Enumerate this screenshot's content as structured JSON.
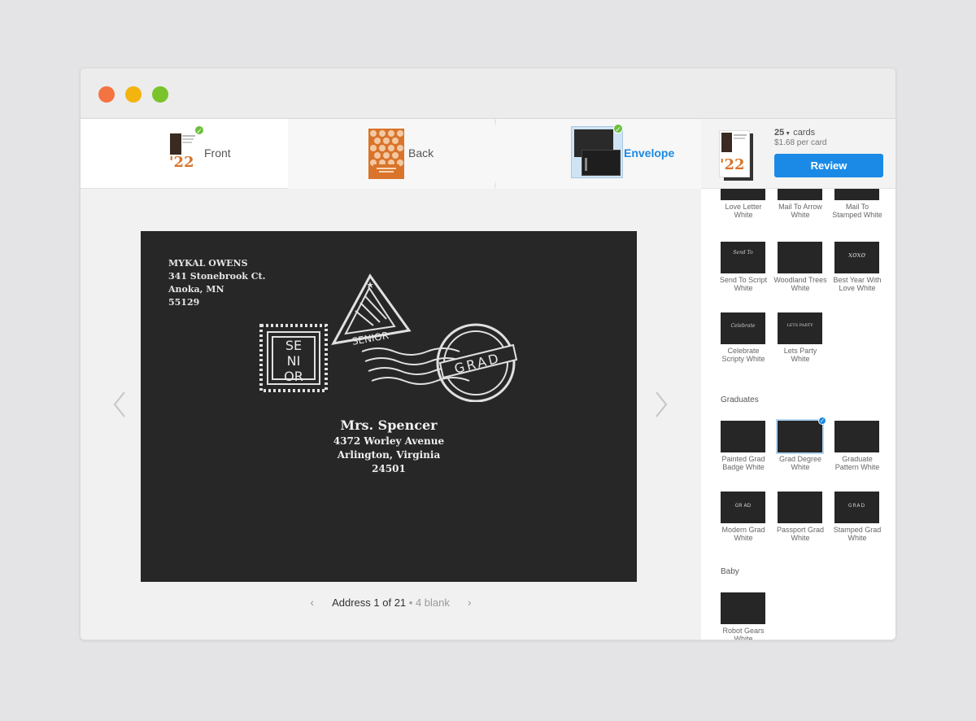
{
  "steps": [
    {
      "label": "Front",
      "completed": true
    },
    {
      "label": "Back",
      "completed": false
    },
    {
      "label": "Envelope",
      "completed": true,
      "active": true
    }
  ],
  "thumb_year": "'22",
  "order": {
    "quantity": "25",
    "unit": "cards",
    "price": "$1.68 per card",
    "review_label": "Review"
  },
  "envelope": {
    "return_address": [
      "MYKAL OWENS",
      "341 Stonebrook Ct.",
      "Anoka, MN",
      "55129"
    ],
    "recipient": {
      "name": "Mrs. Spencer",
      "lines": [
        "4372 Worley Avenue",
        "Arlington, Virginia",
        "24501"
      ]
    },
    "stamps": {
      "square_lines": [
        "SE",
        "NI",
        "OR"
      ],
      "triangle": "SENIOR",
      "round": "GRAD"
    }
  },
  "pager": {
    "label": "Address 1 of 21",
    "separator": "•",
    "blank": "4 blank"
  },
  "sidebar": {
    "sections": [
      {
        "title": "",
        "items": [
          {
            "label": "Love Letter White"
          },
          {
            "label": "Mail To Arrow White"
          },
          {
            "label": "Mail To Stamped White"
          },
          {
            "label": "Send To Script White",
            "inner": "Send To"
          },
          {
            "label": "Woodland Trees White"
          },
          {
            "label": "Best Year With Love White",
            "inner": "xoxo"
          },
          {
            "label": "Celebrate Scripty White",
            "inner": "Celebrate"
          },
          {
            "label": "Lets Party White",
            "inner": "LETS PARTY"
          }
        ]
      },
      {
        "title": "Graduates",
        "items": [
          {
            "label": "Painted Grad Badge White"
          },
          {
            "label": "Grad Degree White",
            "selected": true
          },
          {
            "label": "Graduate Pattern White"
          },
          {
            "label": "Modern Grad White",
            "inner": "GR AD"
          },
          {
            "label": "Passport Grad White"
          },
          {
            "label": "Stamped Grad White",
            "inner": "GRAD"
          }
        ]
      },
      {
        "title": "Baby",
        "items": [
          {
            "label": "Robot Gears White"
          }
        ]
      }
    ]
  },
  "colors": {
    "accent": "#1a8ae6",
    "check": "#6cbf3b",
    "envelope": "#272727",
    "card_orange": "#d9742a"
  }
}
